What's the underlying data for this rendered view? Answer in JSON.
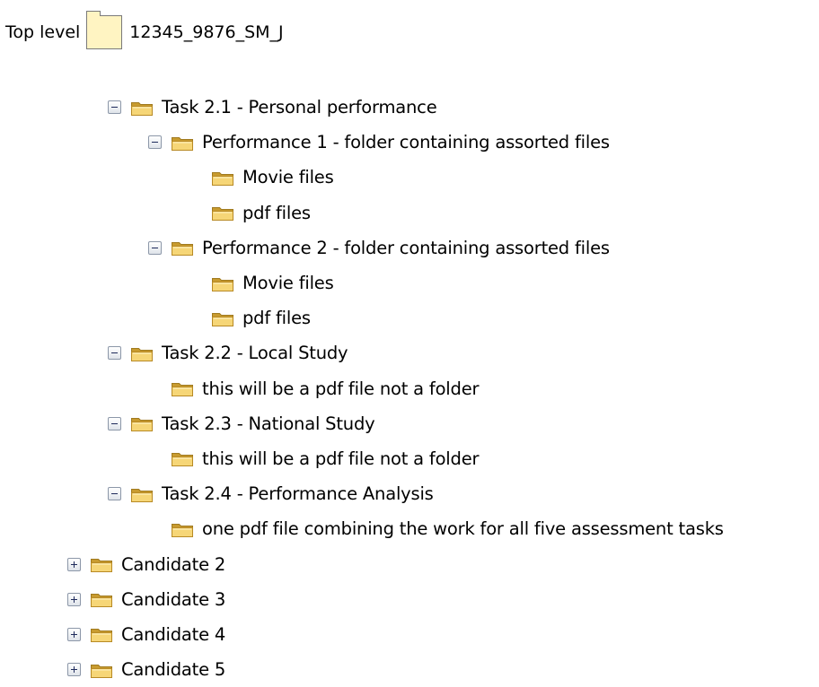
{
  "top_level": {
    "label": "Top level",
    "folder_name": "12345_9876_SM_J"
  },
  "tree": [
    {
      "label": "Task 2.1 - Personal performance",
      "level": 0,
      "toggle": "minus"
    },
    {
      "label": "Performance 1 - folder containing assorted files",
      "level": 1,
      "toggle": "minus"
    },
    {
      "label": "Movie files",
      "level": 2,
      "toggle": "none"
    },
    {
      "label": "pdf files",
      "level": 2,
      "toggle": "none"
    },
    {
      "label": "Performance 2 - folder containing assorted files",
      "level": 1,
      "toggle": "minus"
    },
    {
      "label": "Movie files",
      "level": 2,
      "toggle": "none"
    },
    {
      "label": "pdf files",
      "level": 2,
      "toggle": "none"
    },
    {
      "label": "Task 2.2 - Local Study",
      "level": 0,
      "toggle": "minus"
    },
    {
      "label": "this will be a pdf file not a folder",
      "level": 1,
      "toggle": "none"
    },
    {
      "label": "Task 2.3 - National Study",
      "level": 0,
      "toggle": "minus"
    },
    {
      "label": "this will be a pdf file not a folder",
      "level": 1,
      "toggle": "none"
    },
    {
      "label": "Task 2.4 - Performance Analysis",
      "level": 0,
      "toggle": "minus"
    },
    {
      "label": "one pdf file combining the work for all five assessment tasks",
      "level": 1,
      "toggle": "none"
    },
    {
      "label": "Candidate 2",
      "level": -1,
      "toggle": "plus"
    },
    {
      "label": "Candidate 3",
      "level": -1,
      "toggle": "plus"
    },
    {
      "label": "Candidate 4",
      "level": -1,
      "toggle": "plus"
    },
    {
      "label": "Candidate 5",
      "level": -1,
      "toggle": "plus"
    }
  ],
  "colors": {
    "folder_fill": "#f6d677",
    "folder_dark": "#c89b2f",
    "toggle_border": "#8c97a8"
  },
  "icons": {
    "folder": "folder-icon",
    "expand": "plus-box-icon",
    "collapse": "minus-box-icon"
  }
}
